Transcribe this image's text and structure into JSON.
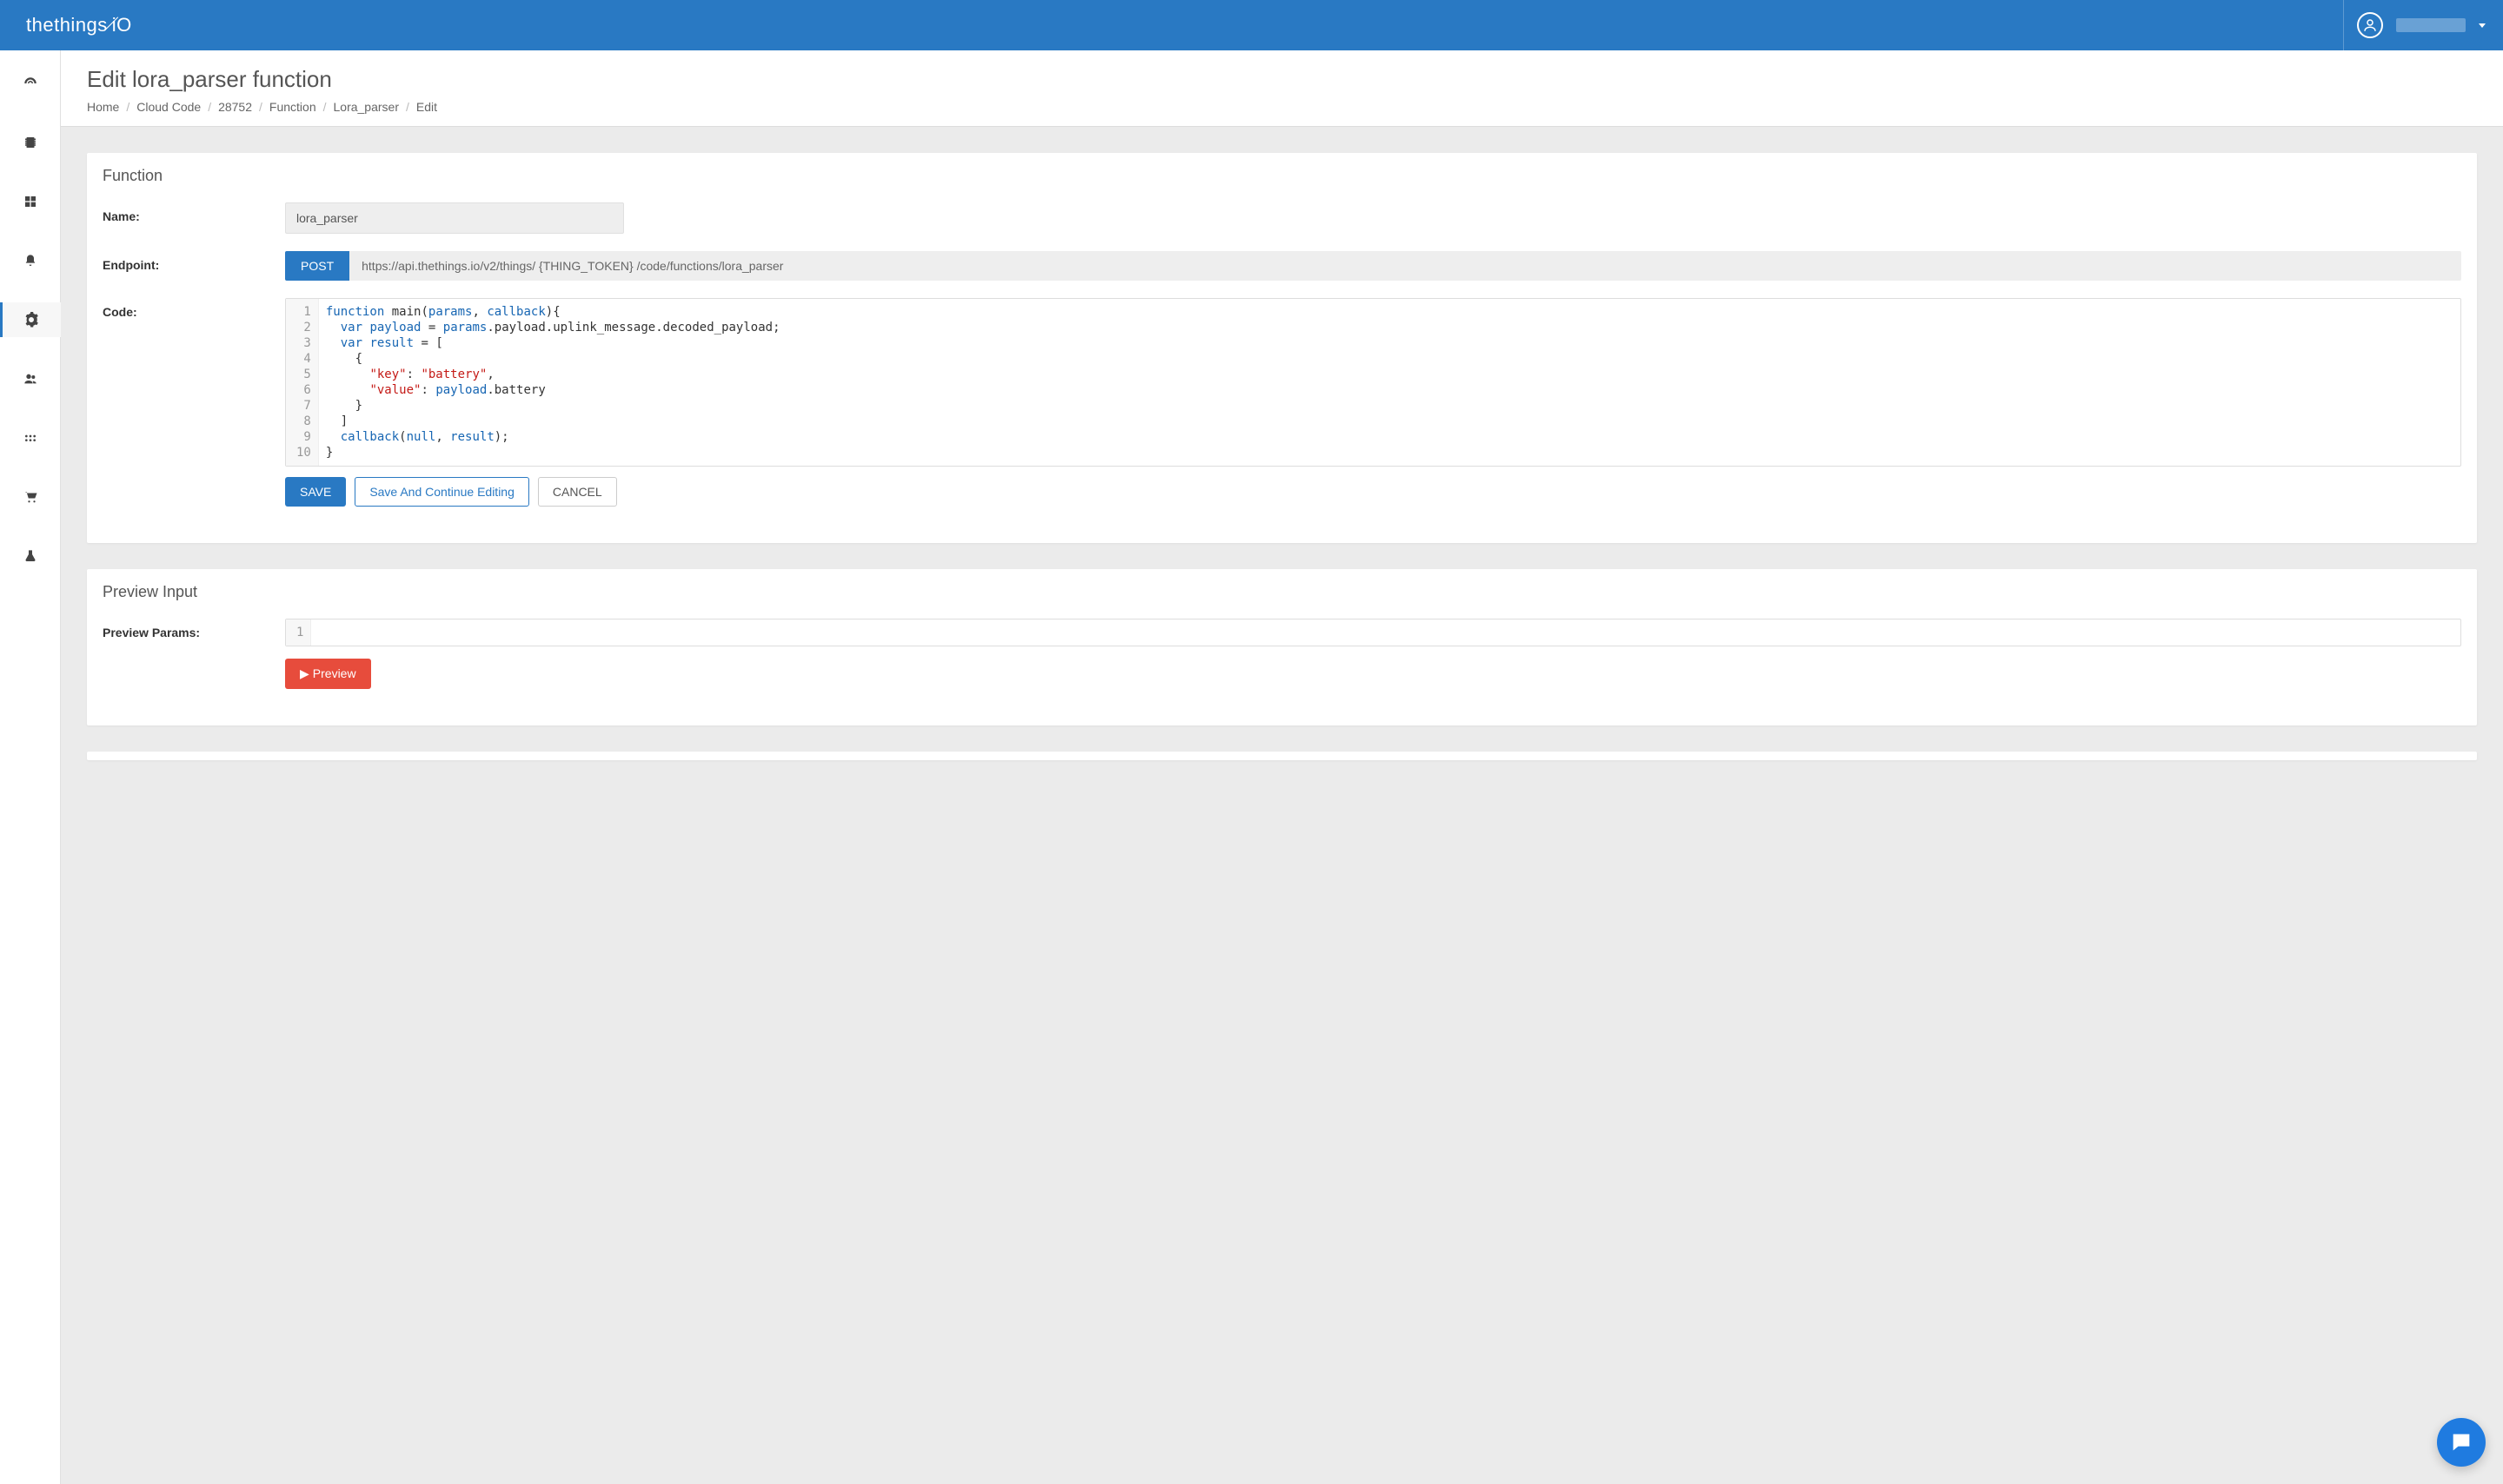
{
  "header": {
    "logo_text": "thethings.iO"
  },
  "page": {
    "title": "Edit lora_parser function"
  },
  "breadcrumb": {
    "items": [
      {
        "label": "Home"
      },
      {
        "label": "Cloud Code"
      },
      {
        "label": "28752"
      },
      {
        "label": "Function"
      },
      {
        "label": "Lora_parser"
      },
      {
        "label": "Edit"
      }
    ]
  },
  "function_panel": {
    "heading": "Function",
    "name_label": "Name:",
    "name_value": "lora_parser",
    "endpoint_label": "Endpoint:",
    "endpoint_method": "POST",
    "endpoint_url": "https://api.thethings.io/v2/things/ {THING_TOKEN} /code/functions/lora_parser",
    "code_label": "Code:",
    "buttons": {
      "save": "SAVE",
      "save_continue": "Save And Continue Editing",
      "cancel": "CANCEL"
    }
  },
  "code_lines": [
    "function main(params, callback){",
    "  var payload = params.payload.uplink_message.decoded_payload;",
    "  var result = [",
    "    {",
    "      \"key\": \"battery\",",
    "      \"value\": payload.battery",
    "    }",
    "  ]",
    "  callback(null, result);",
    "}"
  ],
  "preview_panel": {
    "heading": "Preview Input",
    "params_label": "Preview Params:",
    "preview_button": "Preview"
  }
}
